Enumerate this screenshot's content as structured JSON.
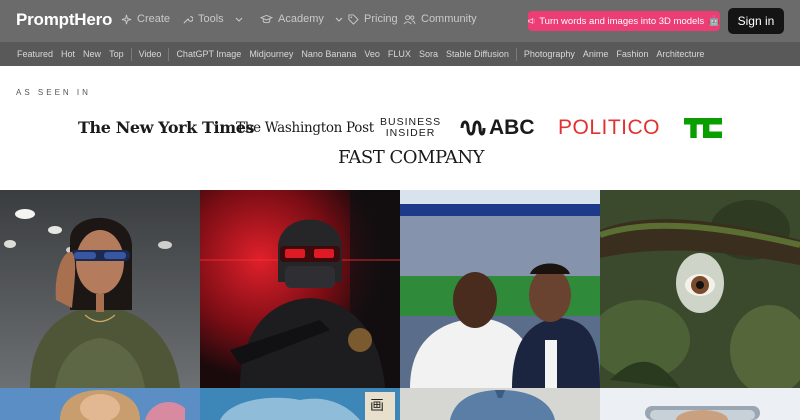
{
  "brand": {
    "name": "PromptHero"
  },
  "nav": {
    "items": [
      {
        "label": "Create",
        "icon": "sparkles-icon"
      },
      {
        "label": "Tools",
        "icon": "wrench-icon"
      },
      {
        "label": "Academy",
        "icon": "graduation-cap-icon"
      },
      {
        "label": "Pricing",
        "icon": "tag-icon"
      },
      {
        "label": "Community",
        "icon": "users-icon"
      }
    ],
    "promo": {
      "label": "Turn words and images into 3D models",
      "icon": "megaphone-icon",
      "emoji": "🤖"
    },
    "signin": "Sign in"
  },
  "categories": [
    "Featured",
    "Hot",
    "New",
    "Top",
    "Video",
    "ChatGPT Image",
    "Midjourney",
    "Nano Banana",
    "Veo",
    "FLUX",
    "Sora",
    "Stable Diffusion",
    "Photography",
    "Anime",
    "Fashion",
    "Architecture"
  ],
  "as_seen_in": {
    "label": "AS SEEN IN",
    "logos": {
      "nyt": "The New York Times",
      "wapo": "The Washington Post",
      "bi_line1": "BUSINESS",
      "bi_line2": "INSIDER",
      "abc": "ABC",
      "politico": "POLITICO",
      "techcrunch": "TC",
      "fastcompany": "FAST COMPANY"
    }
  },
  "gallery": {
    "tiles": [
      {
        "name": "woman-sunglasses-parking-garage"
      },
      {
        "name": "armored-soldier-red-smoke"
      },
      {
        "name": "stadium-selfie-two-men"
      },
      {
        "name": "eye-in-water-droplet-branch"
      },
      {
        "name": "woman-portrait-partial"
      },
      {
        "name": "blue-poster-character-partial"
      },
      {
        "name": "beanie-portrait-partial"
      },
      {
        "name": "framed-portrait-partial"
      }
    ]
  },
  "colors": {
    "promo": "#ec3d74",
    "signin_bg": "#141414",
    "politico": "#e1322f",
    "techcrunch": "#0a9e01"
  }
}
